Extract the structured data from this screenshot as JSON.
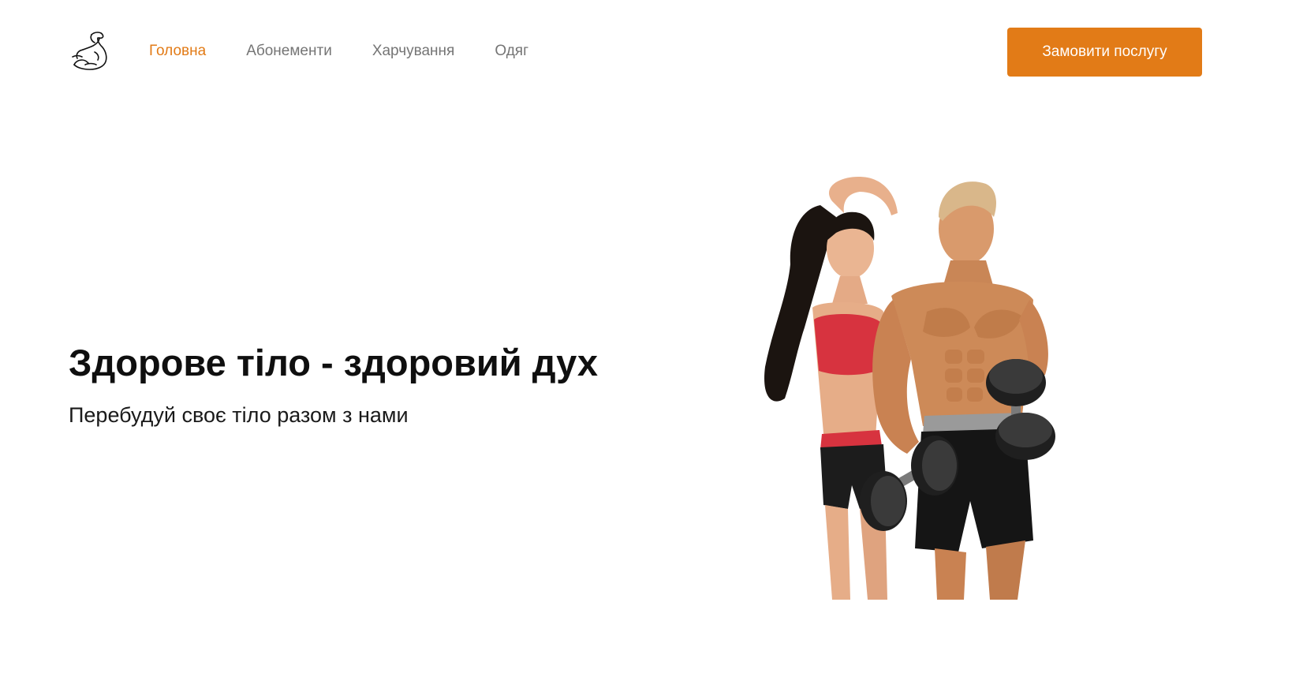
{
  "header": {
    "logo_icon": "flexed-bicep-icon",
    "nav": [
      {
        "label": "Головна",
        "active": true
      },
      {
        "label": "Абонементи",
        "active": false
      },
      {
        "label": "Харчування",
        "active": false
      },
      {
        "label": "Одяг",
        "active": false
      }
    ],
    "cta_label": "Замовити послугу"
  },
  "hero": {
    "title": "Здорове тіло - здоровий дух",
    "subtitle": "Перебудуй своє тіло разом з нами",
    "image_icon": "fitness-couple-with-dumbbells-image"
  },
  "colors": {
    "accent": "#e27b17",
    "nav_text": "#757575",
    "heading": "#0f0f0f",
    "background": "#ffffff"
  }
}
